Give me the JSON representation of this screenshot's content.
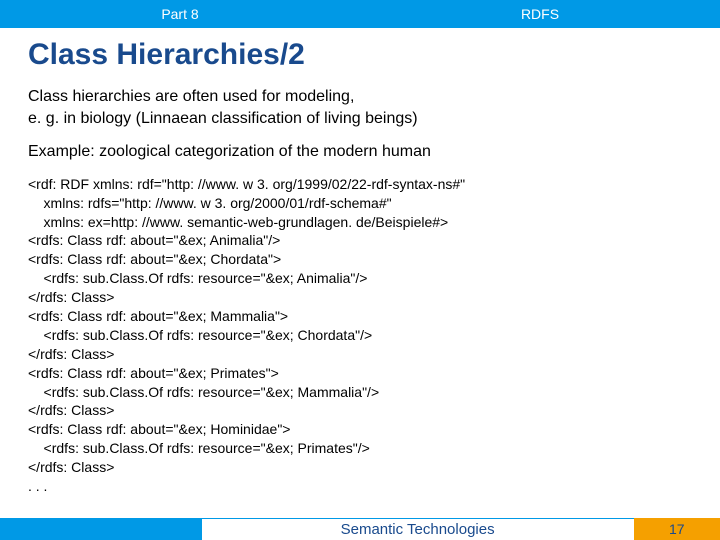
{
  "header": {
    "left": "Part 8",
    "right": "RDFS"
  },
  "title": "Class Hierarchies/2",
  "para1": "Class hierarchies are often used for modeling,\ne. g. in biology (Linnaean classification of living beings)",
  "para2": "Example: zoological categorization of the modern human",
  "code": "<rdf: RDF xmlns: rdf=\"http: //www. w 3. org/1999/02/22-rdf-syntax-ns#\"\n    xmlns: rdfs=\"http: //www. w 3. org/2000/01/rdf-schema#\"\n    xmlns: ex=http: //www. semantic-web-grundlagen. de/Beispiele#>\n<rdfs: Class rdf: about=\"&ex; Animalia\"/>\n<rdfs: Class rdf: about=\"&ex; Chordata\">\n    <rdfs: sub.Class.Of rdfs: resource=\"&ex; Animalia\"/>\n</rdfs: Class>\n<rdfs: Class rdf: about=\"&ex; Mammalia\">\n    <rdfs: sub.Class.Of rdfs: resource=\"&ex; Chordata\"/>\n</rdfs: Class>\n<rdfs: Class rdf: about=\"&ex; Primates\">\n    <rdfs: sub.Class.Of rdfs: resource=\"&ex; Mammalia\"/>\n</rdfs: Class>\n<rdfs: Class rdf: about=\"&ex; Hominidae\">\n    <rdfs: sub.Class.Of rdfs: resource=\"&ex; Primates\"/>\n</rdfs: Class>\n. . .",
  "footer": {
    "center": "Semantic Technologies",
    "page": "17"
  }
}
